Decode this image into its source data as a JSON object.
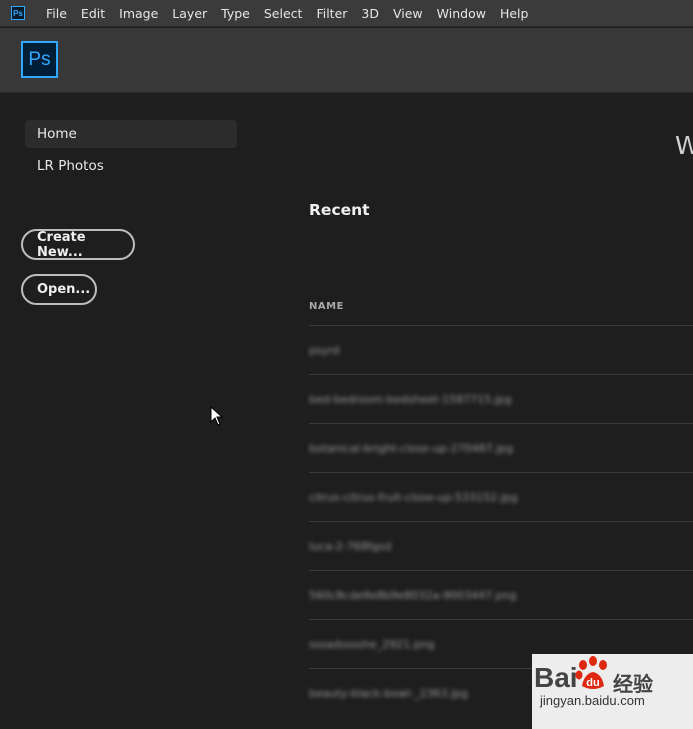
{
  "menubar": {
    "logo_text": "Ps",
    "items": [
      "File",
      "Edit",
      "Image",
      "Layer",
      "Type",
      "Select",
      "Filter",
      "3D",
      "View",
      "Window",
      "Help"
    ]
  },
  "appbar": {
    "logo_text": "Ps"
  },
  "sidebar": {
    "items": [
      {
        "label": "Home",
        "active": true
      },
      {
        "label": "LR Photos",
        "active": false
      }
    ],
    "create_new_label": "Create New...",
    "open_label": "Open..."
  },
  "welcome_partial": "W",
  "recent": {
    "title": "Recent",
    "column_header": "NAME",
    "files": [
      "psyrd",
      "bed-bedroom-bedsheet-1587715.jpg",
      "botanical-bright-close-up-270487.jpg",
      "citrus-citrus-fruit-close-up-533152.jpg",
      "luca-2-768fgsd",
      "560c8cde9e8b9e8032a-9003447.png",
      "sssadsssshe_2921.png",
      "beauty-black-bowl-_2363.jpg"
    ]
  },
  "watermark": {
    "brand": "Bai",
    "brand_suffix": "经验",
    "url": "jingyan.baidu.com"
  },
  "colors": {
    "ps_blue": "#31a8ff",
    "ps_dark": "#001e36",
    "background": "#1e1e1e",
    "menubar": "#3b3b3b",
    "appbar": "#383838"
  }
}
